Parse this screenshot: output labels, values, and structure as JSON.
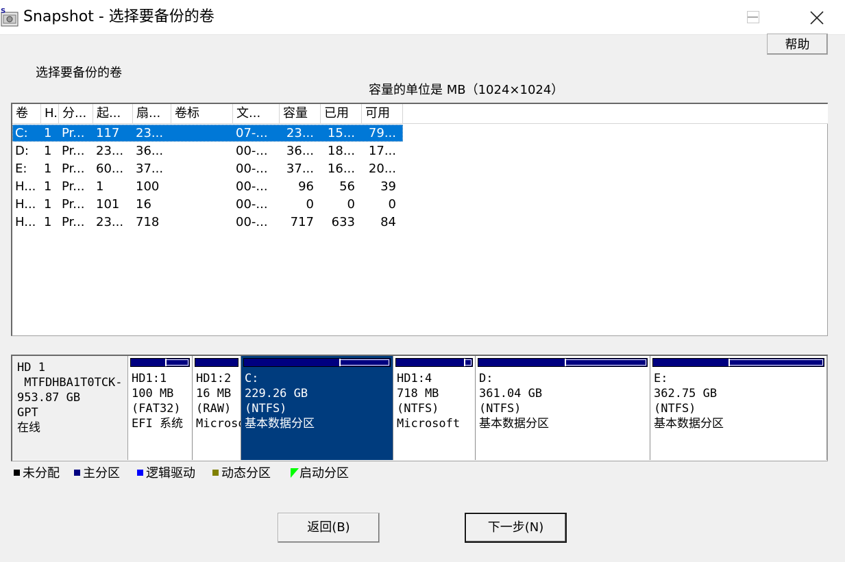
{
  "window": {
    "title": "Snapshot - 选择要备份的卷",
    "app_icon_letter": "S"
  },
  "help_label": "帮助",
  "select_label": "选择要备份的卷",
  "unit_label": "容量的单位是 MB（1024×1024）",
  "table": {
    "columns": [
      "卷",
      "H.",
      "分...",
      "起...",
      "扇...",
      "卷标",
      "文...",
      "容量",
      "已用",
      "可用"
    ],
    "rows": [
      {
        "vol": "C:",
        "h": "1",
        "type": "Pr...",
        "start": "117",
        "sectors": "23...",
        "label": "",
        "fs": "07-...",
        "size": "23...",
        "used": "15...",
        "free": "79...",
        "selected": true
      },
      {
        "vol": "D:",
        "h": "1",
        "type": "Pr...",
        "start": "23...",
        "sectors": "36...",
        "label": "",
        "fs": "00-...",
        "size": "36...",
        "used": "18...",
        "free": "17...",
        "selected": false
      },
      {
        "vol": "E:",
        "h": "1",
        "type": "Pr...",
        "start": "60...",
        "sectors": "37...",
        "label": "",
        "fs": "00-...",
        "size": "37...",
        "used": "16...",
        "free": "20...",
        "selected": false
      },
      {
        "vol": "H...",
        "h": "1",
        "type": "Pr...",
        "start": "1",
        "sectors": "100",
        "label": "",
        "fs": "00-...",
        "size": "96",
        "used": "56",
        "free": "39",
        "selected": false
      },
      {
        "vol": "H...",
        "h": "1",
        "type": "Pr...",
        "start": "101",
        "sectors": "16",
        "label": "",
        "fs": "00-...",
        "size": "0",
        "used": "0",
        "free": "0",
        "selected": false
      },
      {
        "vol": "H...",
        "h": "1",
        "type": "Pr...",
        "start": "23...",
        "sectors": "718",
        "label": "",
        "fs": "00-...",
        "size": "717",
        "used": "633",
        "free": "84",
        "selected": false
      }
    ]
  },
  "disk": {
    "info": [
      "HD 1",
      " MTFDHBA1T0TCK-",
      "953.87 GB",
      "GPT",
      "在线"
    ],
    "partitions": [
      {
        "id": "hd1-1",
        "lines": [
          "HD1:1",
          "100 MB",
          "(FAT32)",
          "EFI 系统"
        ],
        "used_fraction": 0.58,
        "active": false
      },
      {
        "id": "hd1-2",
        "lines": [
          "HD1:2",
          "16 MB",
          "(RAW)",
          "Microsoft"
        ],
        "used_fraction": 0.0,
        "active": false
      },
      {
        "id": "c",
        "lines": [
          "C:",
          "229.26 GB",
          "(NTFS)",
          "基本数据分区"
        ],
        "used_fraction": 0.65,
        "active": true
      },
      {
        "id": "hd1-4",
        "lines": [
          "HD1:4",
          "718 MB",
          "(NTFS)",
          "Microsoft"
        ],
        "used_fraction": 0.88,
        "active": false
      },
      {
        "id": "d",
        "lines": [
          "D:",
          "361.04 GB",
          "(NTFS)",
          "基本数据分区"
        ],
        "used_fraction": 0.51,
        "active": false
      },
      {
        "id": "e",
        "lines": [
          "E:",
          "362.75 GB",
          "(NTFS)",
          "基本数据分区"
        ],
        "used_fraction": 0.44,
        "active": false
      }
    ]
  },
  "legend": [
    {
      "label": "未分配",
      "color": "#000000"
    },
    {
      "label": "主分区",
      "color": "#000080"
    },
    {
      "label": "逻辑驱动",
      "color": "#0000ff"
    },
    {
      "label": "动态分区",
      "color": "#808000"
    },
    {
      "label": "启动分区",
      "color": "#00ff00"
    }
  ],
  "buttons": {
    "back_label": "返回(B)",
    "next_label": "下一步(N)"
  }
}
